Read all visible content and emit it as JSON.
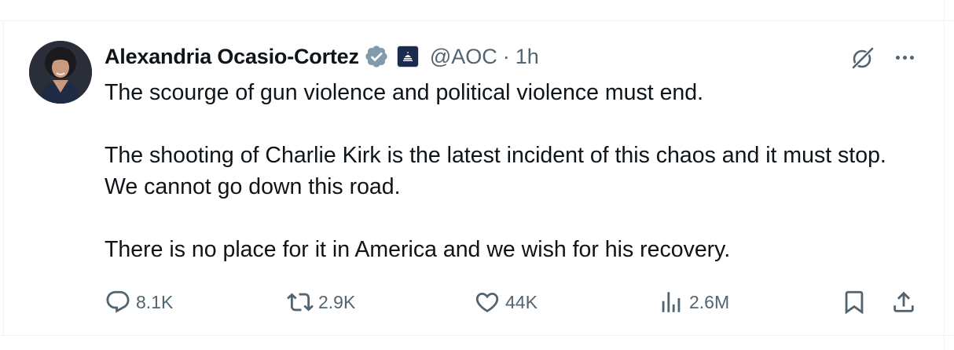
{
  "post": {
    "author_name": "Alexandria Ocasio-Cortez",
    "handle": "@AOC",
    "separator": "·",
    "time": "1h",
    "text_lines": [
      "The scourge of gun violence and political violence must end.",
      "The shooting of Charlie Kirk is the latest incident of this chaos and it must stop. We cannot go down this road.",
      "There is no place for it in America and we wish for his recovery."
    ]
  },
  "icons": {
    "avatar": "profile-photo",
    "verified": "verified-badge-icon",
    "affiliation": "capitol-icon",
    "grok": "grok-icon",
    "more": "more-icon",
    "reply": "reply-icon",
    "repost": "repost-icon",
    "like": "like-icon",
    "views": "views-icon",
    "bookmark": "bookmark-icon",
    "share": "share-icon"
  },
  "actions": {
    "reply_count": "8.1K",
    "repost_count": "2.9K",
    "like_count": "44K",
    "views_count": "2.6M"
  },
  "colors": {
    "text_primary": "#0f1419",
    "text_secondary": "#536471",
    "verified_badge": "#829aab",
    "divider": "#eff3f4"
  }
}
